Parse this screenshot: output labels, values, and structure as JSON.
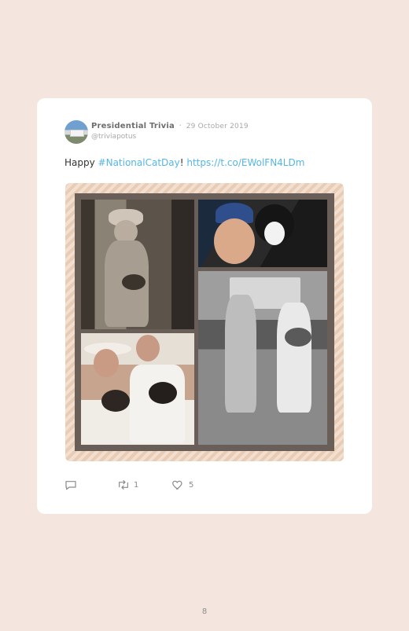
{
  "tweet": {
    "author_name": "Presidential Trivia",
    "separator": "·",
    "date": "29 October 2019",
    "handle": "@triviapotus",
    "text_prefix": "Happy ",
    "hashtag": "#NationalCatDay",
    "text_middle": "! ",
    "link": "https://t.co/EWolFN4LDm"
  },
  "actions": {
    "reply_count": "",
    "retweet_count": "1",
    "like_count": "5"
  },
  "icons": {
    "reply": "reply-icon",
    "retweet": "retweet-icon",
    "like": "heart-icon"
  },
  "colors": {
    "background": "#f4e6df",
    "link": "#55b6e6",
    "frame_stripe_a": "#e9ccb6",
    "frame_stripe_b": "#f2dfd0"
  },
  "page": {
    "number": "8"
  }
}
